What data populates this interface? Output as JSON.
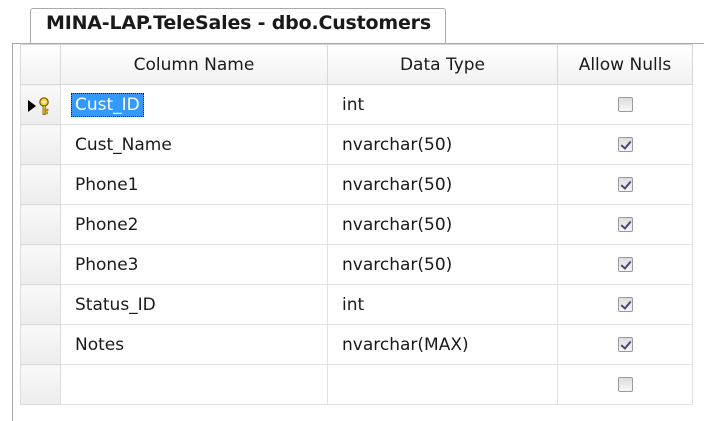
{
  "document_tab": {
    "title": "MINA-LAP.TeleSales - dbo.Customers"
  },
  "grid": {
    "headers": {
      "column_name": "Column Name",
      "data_type": "Data Type",
      "allow_nulls": "Allow Nulls"
    },
    "rows": [
      {
        "name": "Cust_ID",
        "type": "int",
        "allow_nulls": false,
        "primary_key": true,
        "selected": true
      },
      {
        "name": "Cust_Name",
        "type": "nvarchar(50)",
        "allow_nulls": true
      },
      {
        "name": "Phone1",
        "type": "nvarchar(50)",
        "allow_nulls": true
      },
      {
        "name": "Phone2",
        "type": "nvarchar(50)",
        "allow_nulls": true
      },
      {
        "name": "Phone3",
        "type": "nvarchar(50)",
        "allow_nulls": true
      },
      {
        "name": "Status_ID",
        "type": "int",
        "allow_nulls": true
      },
      {
        "name": "Notes",
        "type": "nvarchar(MAX)",
        "allow_nulls": true
      },
      {
        "name": "",
        "type": "",
        "allow_nulls": false
      }
    ]
  },
  "icons": {
    "row_marker": "current-row-arrow-icon",
    "primary_key": "key-icon"
  },
  "colors": {
    "selection": "#3399ff",
    "check": "#4a4a7a"
  }
}
